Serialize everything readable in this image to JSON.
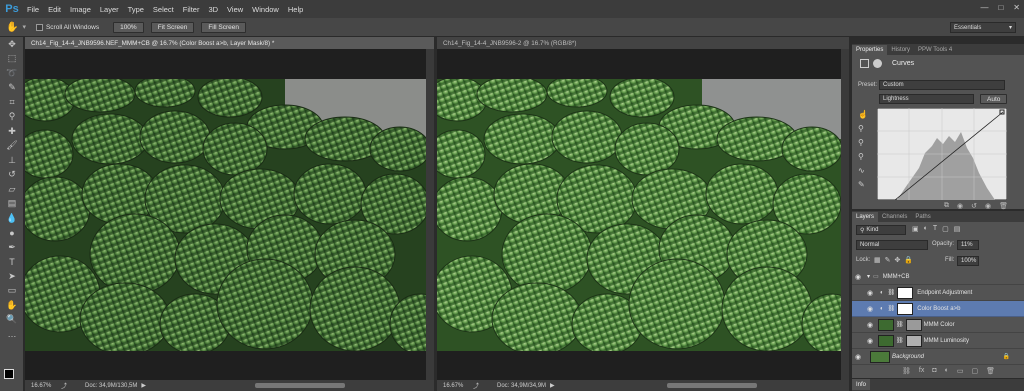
{
  "app": {
    "logo": "Ps",
    "menus": [
      "File",
      "Edit",
      "Image",
      "Layer",
      "Type",
      "Select",
      "Filter",
      "3D",
      "View",
      "Window",
      "Help"
    ],
    "workspace": "Essentials",
    "win_controls": [
      "—",
      "□",
      "✕"
    ]
  },
  "options": {
    "scroll_all_label": "Scroll All Windows",
    "btn_100": "100%",
    "btn_fit": "Fit Screen",
    "btn_fill": "Fill Screen"
  },
  "doc_left": {
    "tab": "Ch14_Fig_14-4_JNB9596.NEF_MMM+CB @ 16.7% (Color Boost a>b, Layer Mask/8) *",
    "zoom": "16.67%",
    "doc": "Doc: 34,9M/130,5M"
  },
  "doc_right": {
    "tab": "Ch14_Fig_14-4_JNB9596-2 @ 16.7% (RGB/8*)",
    "zoom": "16.67%",
    "doc": "Doc: 34,9M/34,9M"
  },
  "properties": {
    "tabs": [
      "Properties",
      "History",
      "PPW Tools 4"
    ],
    "title": "Curves",
    "preset_label": "Preset:",
    "preset_value": "Custom",
    "channel": "Lightness",
    "auto": "Auto"
  },
  "layers_panel": {
    "tabs": [
      "Layers",
      "Channels",
      "Paths"
    ],
    "kind": "Kind",
    "blend": "Normal",
    "opacity_label": "Opacity:",
    "opacity": "11%",
    "lock_label": "Lock:",
    "fill_label": "Fill:",
    "fill": "100%",
    "group": "MMM+CB",
    "layers": [
      {
        "name": "Endpoint Adjustment",
        "selected": false
      },
      {
        "name": "Color Boost a>b",
        "selected": true
      },
      {
        "name": "MMM Color",
        "selected": false
      },
      {
        "name": "MMM Luminosity",
        "selected": false
      }
    ],
    "background": "Background"
  },
  "info_tab": "Info",
  "colors": {
    "accent": "#5d7bb0",
    "ps_blue": "#3d9bd8"
  }
}
